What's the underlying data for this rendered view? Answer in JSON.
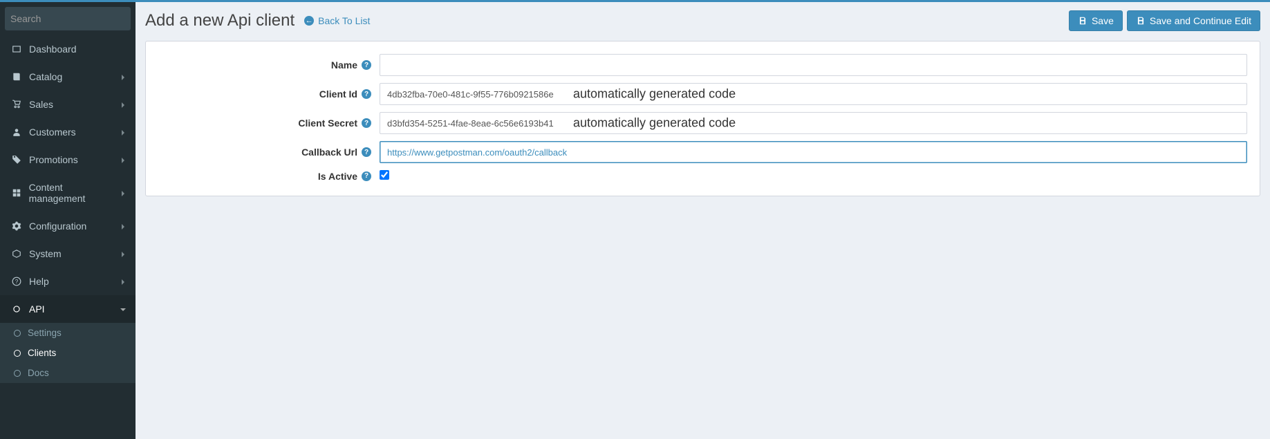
{
  "search": {
    "placeholder": "Search"
  },
  "sidebar": {
    "items": [
      {
        "label": "Dashboard"
      },
      {
        "label": "Catalog"
      },
      {
        "label": "Sales"
      },
      {
        "label": "Customers"
      },
      {
        "label": "Promotions"
      },
      {
        "label": "Content management"
      },
      {
        "label": "Configuration"
      },
      {
        "label": "System"
      },
      {
        "label": "Help"
      },
      {
        "label": "API"
      }
    ],
    "api_sub": [
      {
        "label": "Settings"
      },
      {
        "label": "Clients"
      },
      {
        "label": "Docs"
      }
    ]
  },
  "header": {
    "title": "Add a new Api client",
    "back": "Back To List",
    "save": "Save",
    "save_continue": "Save and Continue Edit"
  },
  "form": {
    "name_label": "Name",
    "name_value": "",
    "client_id_label": "Client Id",
    "client_id_value": "4db32fba-70e0-481c-9f55-776b0921586e",
    "client_secret_label": "Client Secret",
    "client_secret_value": "d3bfd354-5251-4fae-8eae-6c56e6193b41",
    "callback_label": "Callback Url",
    "callback_value": "https://www.getpostman.com/oauth2/callback",
    "is_active_label": "Is Active",
    "is_active_checked": true
  },
  "annotations": {
    "auto_generated": "automatically generated code"
  }
}
